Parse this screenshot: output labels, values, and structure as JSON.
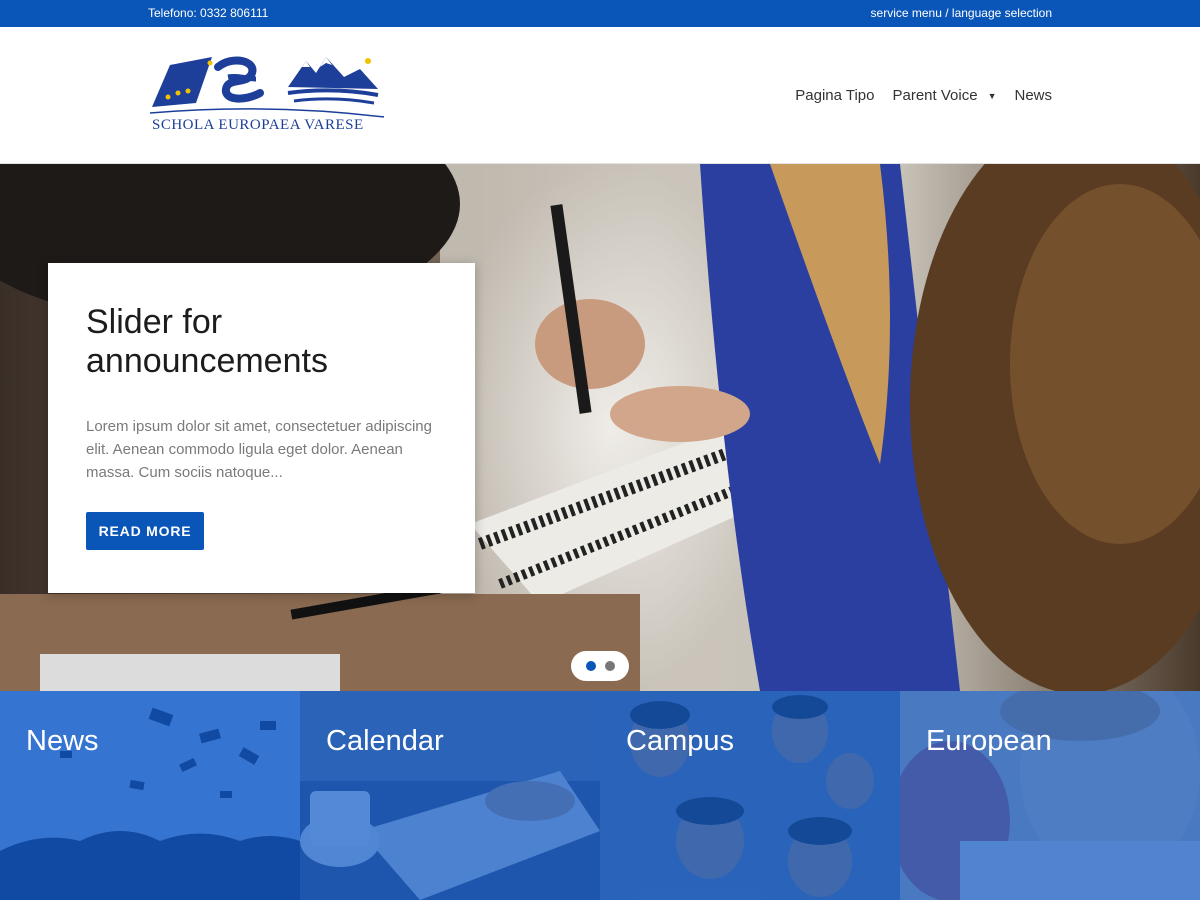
{
  "topbar": {
    "phone": "Telefono: 0332 806111",
    "service_menu": "service menu / language selection"
  },
  "logo": {
    "text": "SCHOLA EUROPAEA VARESE",
    "icon": "school-logo"
  },
  "nav": {
    "items": [
      {
        "label": "Pagina Tipo",
        "has_dropdown": false
      },
      {
        "label": "Parent Voice",
        "has_dropdown": true
      },
      {
        "label": "News",
        "has_dropdown": false
      }
    ],
    "dropdown_icon": "caret-down-icon"
  },
  "hero": {
    "title": "Slider for announcements",
    "excerpt": "Lorem ipsum dolor sit amet, consectetuer adipiscing elit. Aenean commodo ligula eget dolor. Aenean massa. Cum sociis natoque...",
    "button_label": "READ MORE",
    "slides_count": 2,
    "active_slide": 1
  },
  "tiles": [
    {
      "label": "News",
      "image": "graduation-caps-photo"
    },
    {
      "label": "Calendar",
      "image": "coffee-notebook-photo"
    },
    {
      "label": "Campus",
      "image": "children-photo"
    },
    {
      "label": "European",
      "image": "child-drawing-photo"
    }
  ],
  "colors": {
    "brand_blue": "#0a55b8",
    "tile_overlay": "#125cc8"
  }
}
